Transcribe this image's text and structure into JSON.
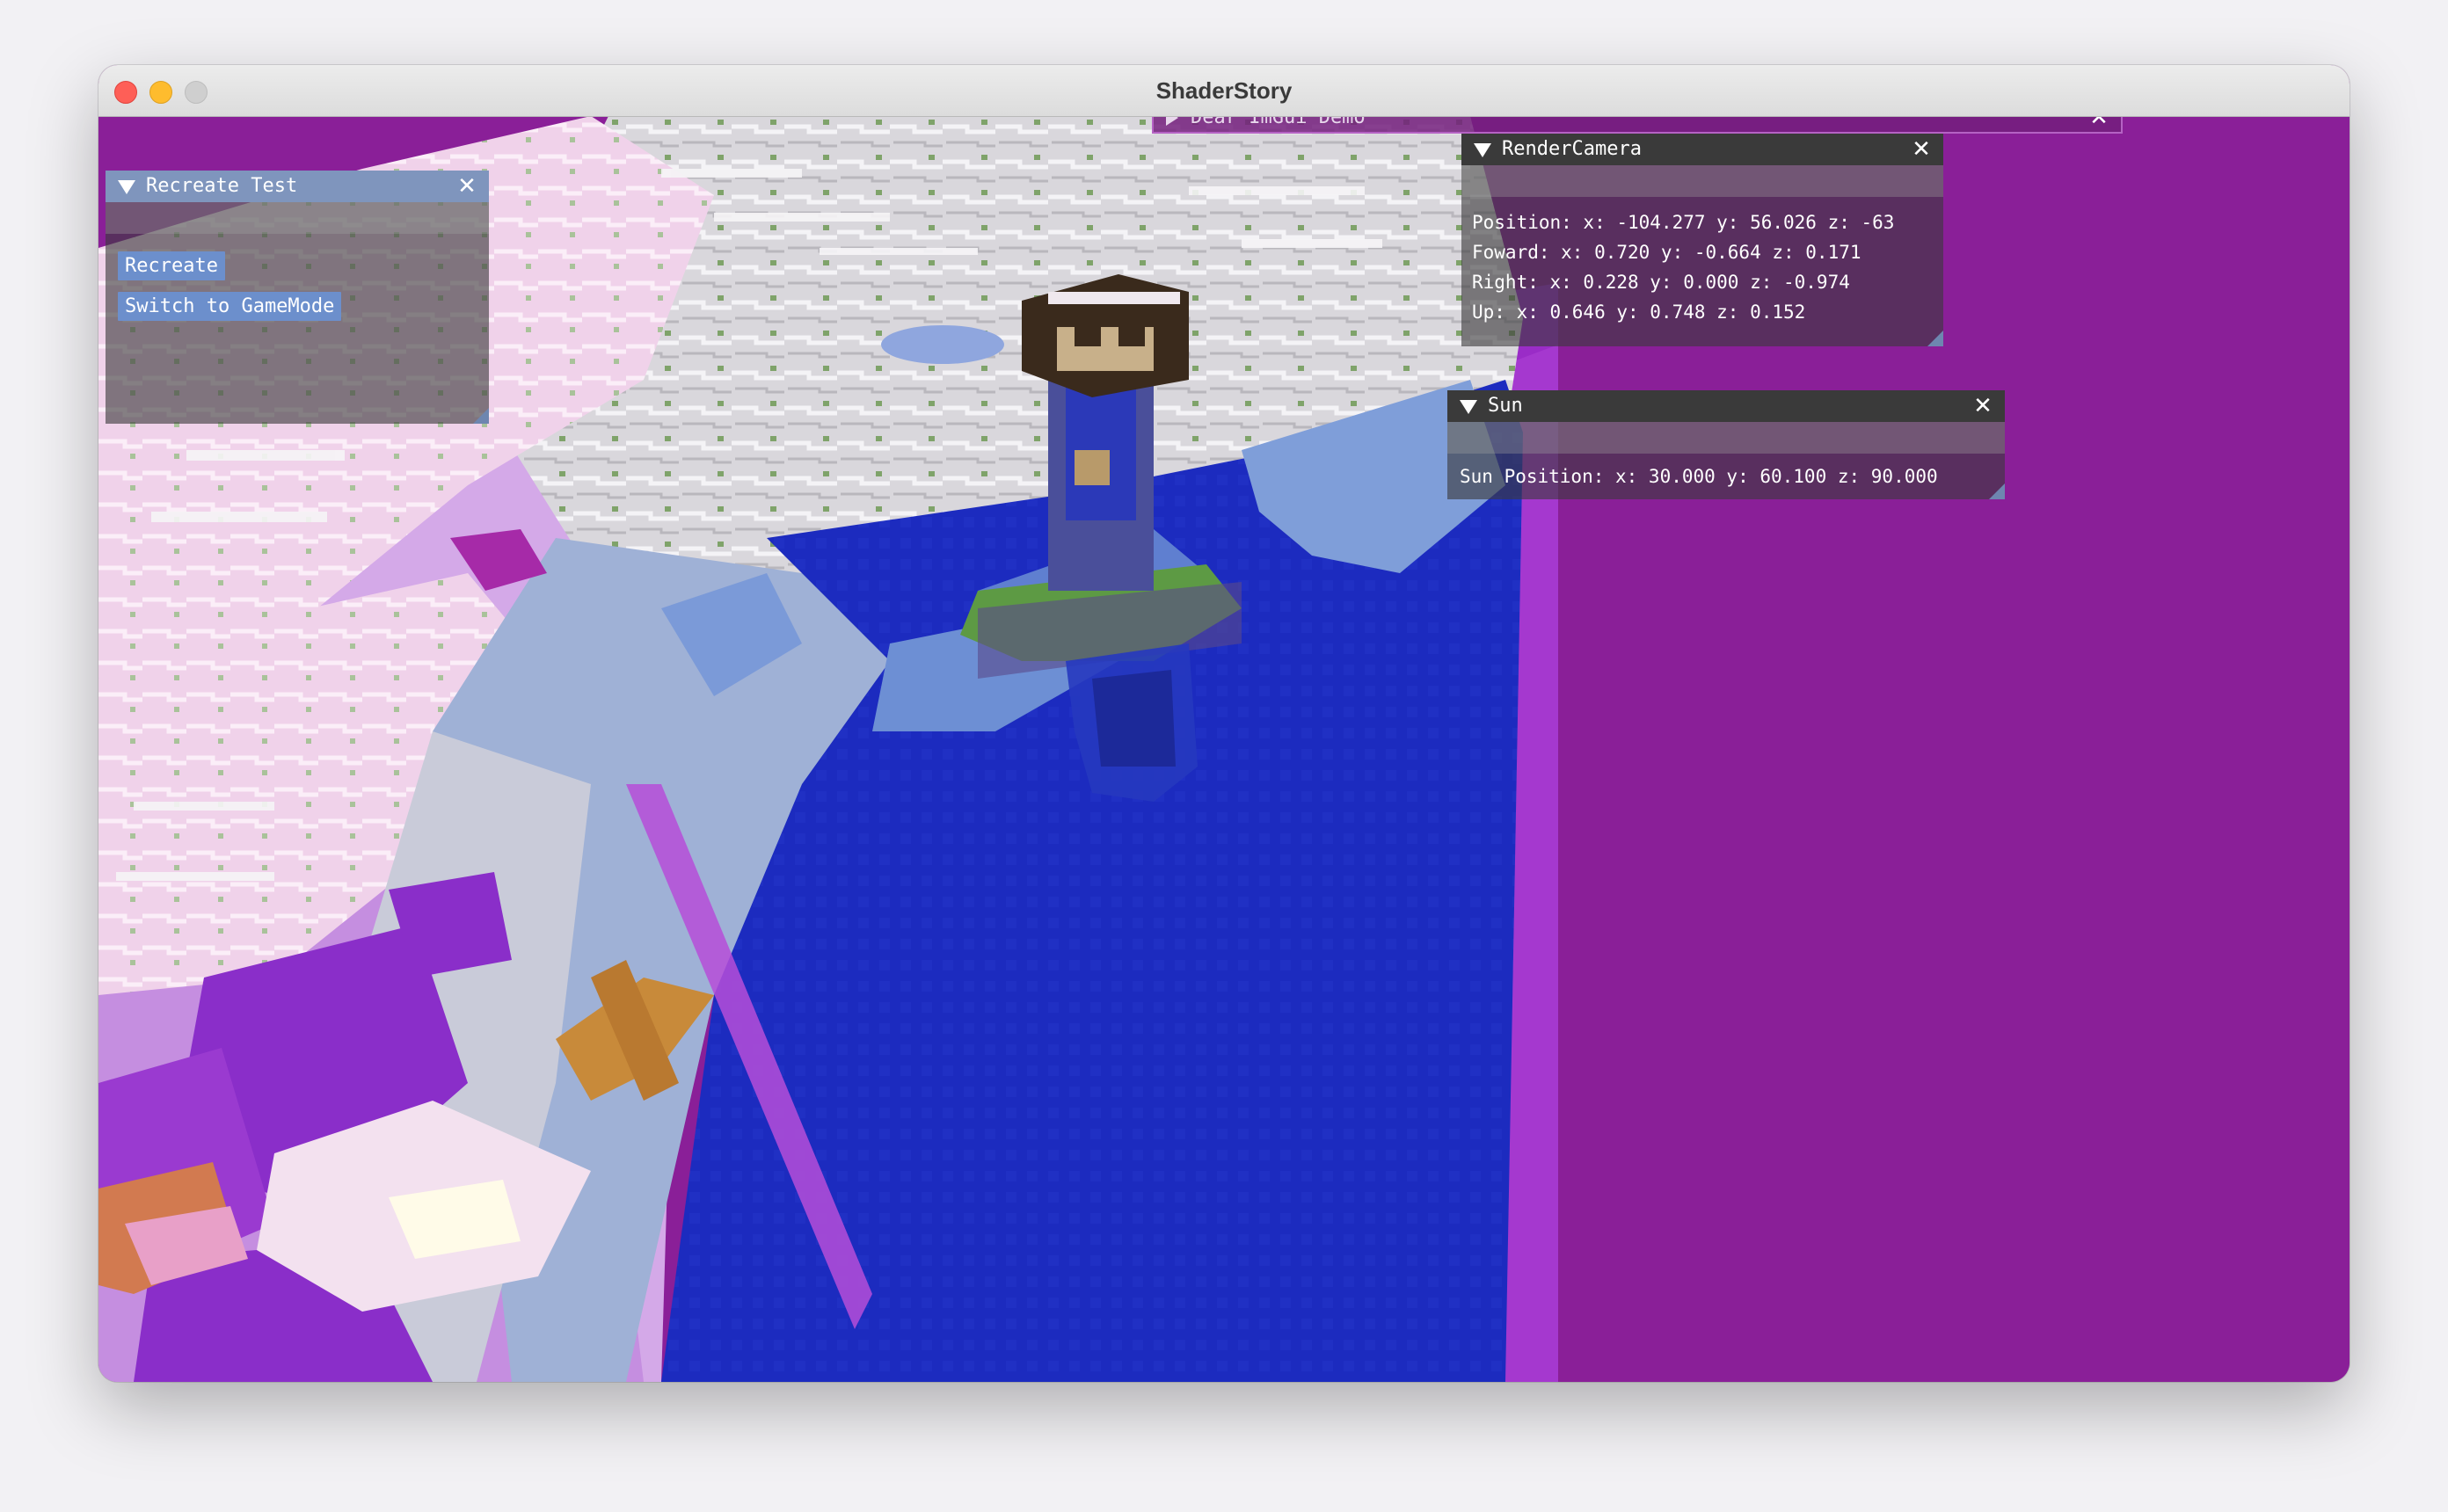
{
  "window": {
    "title": "ShaderStory"
  },
  "colors": {
    "void": "#8a1f98",
    "water": "#1c2bbf",
    "snow": "#d4d2d7",
    "pink_snow": "#f2d6ec"
  },
  "imgui": {
    "recreate_test": {
      "title": "Recreate Test",
      "buttons": [
        "Recreate",
        "Switch to GameMode"
      ]
    },
    "demo": {
      "title": "Dear ImGui Demo"
    },
    "render_camera": {
      "title": "RenderCamera",
      "lines": [
        "Position: x: -104.277 y: 56.026 z: -63",
        "Foward: x: 0.720 y: -0.664 z: 0.171",
        "Right: x: 0.228 y: 0.000 z: -0.974",
        "Up: x: 0.646 y: 0.748 z: 0.152"
      ]
    },
    "sun": {
      "title": "Sun",
      "position_text": "Sun Position: x: 30.000 y: 60.100 z: 90.000"
    }
  }
}
